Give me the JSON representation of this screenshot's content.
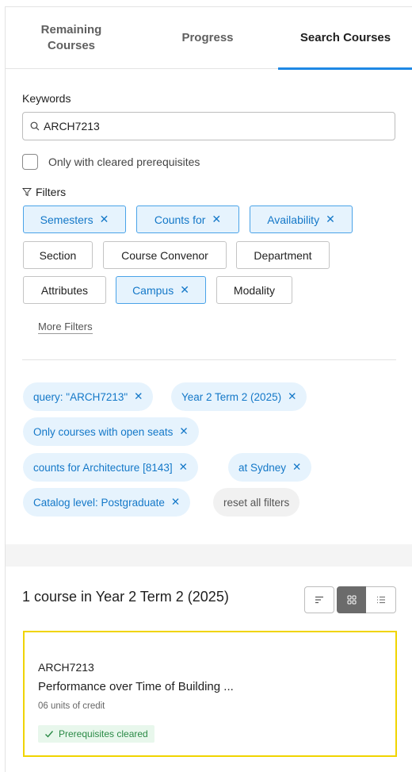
{
  "tabs": [
    {
      "label_line1": "Remaining",
      "label_line2": "Courses"
    },
    {
      "label": "Progress"
    },
    {
      "label": "Search Courses",
      "active": true
    }
  ],
  "search": {
    "keywords_label": "Keywords",
    "value": "ARCH7213",
    "icon": "search-icon"
  },
  "prereq_checkbox": {
    "label": "Only with cleared prerequisites",
    "checked": false
  },
  "filters": {
    "heading": "Filters",
    "icon": "filter-funnel-icon",
    "buttons": [
      {
        "label": "Semesters",
        "active": true
      },
      {
        "label": "Counts for",
        "active": true
      },
      {
        "label": "Availability",
        "active": true
      },
      {
        "label": "Section",
        "active": false
      },
      {
        "label": "Course Convenor",
        "active": false
      },
      {
        "label": "Department",
        "active": false
      },
      {
        "label": "Attributes",
        "active": false
      },
      {
        "label": "Campus",
        "active": true
      },
      {
        "label": "Modality",
        "active": false
      }
    ],
    "more_filters": "More Filters",
    "close_glyph": "✕"
  },
  "active_chips": [
    {
      "label": "query: \"ARCH7213\""
    },
    {
      "label": "Year 2 Term 2 (2025)"
    },
    {
      "label": "Only courses with open seats"
    },
    {
      "label": "counts for Architecture [8143]"
    },
    {
      "label": "at Sydney"
    },
    {
      "label": "Catalog level: Postgraduate"
    }
  ],
  "reset_label": "reset all filters",
  "results": {
    "title": "1 course in Year 2 Term 2 (2025)",
    "view_modes": [
      "sort-icon",
      "grid-view-icon",
      "list-view-icon"
    ],
    "selected_view": "grid-view-icon"
  },
  "course": {
    "code": "ARCH7213",
    "name": "Performance over Time of Building ...",
    "units": "06 units of credit",
    "badge": "Prerequisites cleared"
  },
  "colors": {
    "accent": "#1e88e5",
    "chip_bg": "#e6f3fd",
    "chip_text": "#1478c8",
    "highlight_border": "#f0d400",
    "badge_bg": "#e8f7ec",
    "badge_text": "#2a8a46"
  }
}
